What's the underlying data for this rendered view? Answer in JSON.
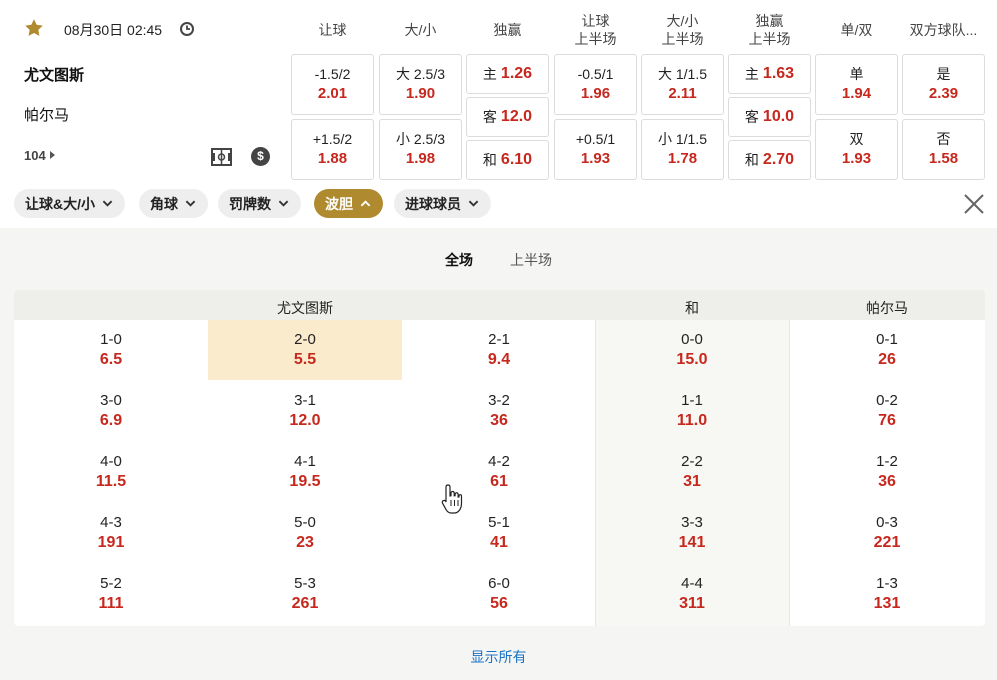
{
  "match": {
    "datetime": "08月30日 02:45",
    "home": "尤文图斯",
    "away": "帕尔马",
    "market_count": "104"
  },
  "columns": [
    "让球",
    "大/小",
    "独赢",
    "让球\n上半场",
    "大/小\n上半场",
    "独赢\n上半场",
    "单/双",
    "双方球队..."
  ],
  "odds": {
    "handicap": [
      {
        "label": "-1.5/2",
        "value": "2.01"
      },
      {
        "label": "+1.5/2",
        "value": "1.88"
      }
    ],
    "total": [
      {
        "label": "大 2.5/3",
        "value": "1.90"
      },
      {
        "label": "小 2.5/3",
        "value": "1.98"
      }
    ],
    "moneyline": [
      {
        "label": "主",
        "value": "1.26"
      },
      {
        "label": "客",
        "value": "12.0"
      },
      {
        "label": "和",
        "value": "6.10"
      }
    ],
    "handicap_1h": [
      {
        "label": "-0.5/1",
        "value": "1.96"
      },
      {
        "label": "+0.5/1",
        "value": "1.93"
      }
    ],
    "total_1h": [
      {
        "label": "大 1/1.5",
        "value": "2.11"
      },
      {
        "label": "小 1/1.5",
        "value": "1.78"
      }
    ],
    "moneyline_1h": [
      {
        "label": "主",
        "value": "1.63"
      },
      {
        "label": "客",
        "value": "10.0"
      },
      {
        "label": "和",
        "value": "2.70"
      }
    ],
    "odd_even": [
      {
        "label": "单",
        "value": "1.94"
      },
      {
        "label": "双",
        "value": "1.93"
      }
    ],
    "btts": [
      {
        "label": "是",
        "value": "2.39"
      },
      {
        "label": "否",
        "value": "1.58"
      }
    ]
  },
  "filters": [
    "让球&大/小",
    "角球",
    "罚牌数",
    "波胆",
    "进球球员"
  ],
  "active_filter": "波胆",
  "period_tabs": {
    "full": "全场",
    "first_half": "上半场"
  },
  "correct_score": {
    "headers": {
      "home": "尤文图斯",
      "draw": "和",
      "away": "帕尔马"
    },
    "rows": [
      [
        {
          "s": "1-0",
          "o": "6.5"
        },
        {
          "s": "2-0",
          "o": "5.5"
        },
        {
          "s": "2-1",
          "o": "9.4"
        },
        {
          "s": "0-0",
          "o": "15.0"
        },
        {
          "s": "0-1",
          "o": "26"
        }
      ],
      [
        {
          "s": "3-0",
          "o": "6.9"
        },
        {
          "s": "3-1",
          "o": "12.0"
        },
        {
          "s": "3-2",
          "o": "36"
        },
        {
          "s": "1-1",
          "o": "11.0"
        },
        {
          "s": "0-2",
          "o": "76"
        }
      ],
      [
        {
          "s": "4-0",
          "o": "11.5"
        },
        {
          "s": "4-1",
          "o": "19.5"
        },
        {
          "s": "4-2",
          "o": "61"
        },
        {
          "s": "2-2",
          "o": "31"
        },
        {
          "s": "1-2",
          "o": "36"
        }
      ],
      [
        {
          "s": "4-3",
          "o": "191"
        },
        {
          "s": "5-0",
          "o": "23"
        },
        {
          "s": "5-1",
          "o": "41"
        },
        {
          "s": "3-3",
          "o": "141"
        },
        {
          "s": "0-3",
          "o": "221"
        }
      ],
      [
        {
          "s": "5-2",
          "o": "111"
        },
        {
          "s": "5-3",
          "o": "261"
        },
        {
          "s": "6-0",
          "o": "56"
        },
        {
          "s": "4-4",
          "o": "311"
        },
        {
          "s": "1-3",
          "o": "131"
        }
      ]
    ]
  },
  "show_all": "显示所有",
  "colors": {
    "odds": "#c6281e",
    "accent": "#b08a2e",
    "highlight": "#faebcd",
    "link": "#1a73c8"
  }
}
